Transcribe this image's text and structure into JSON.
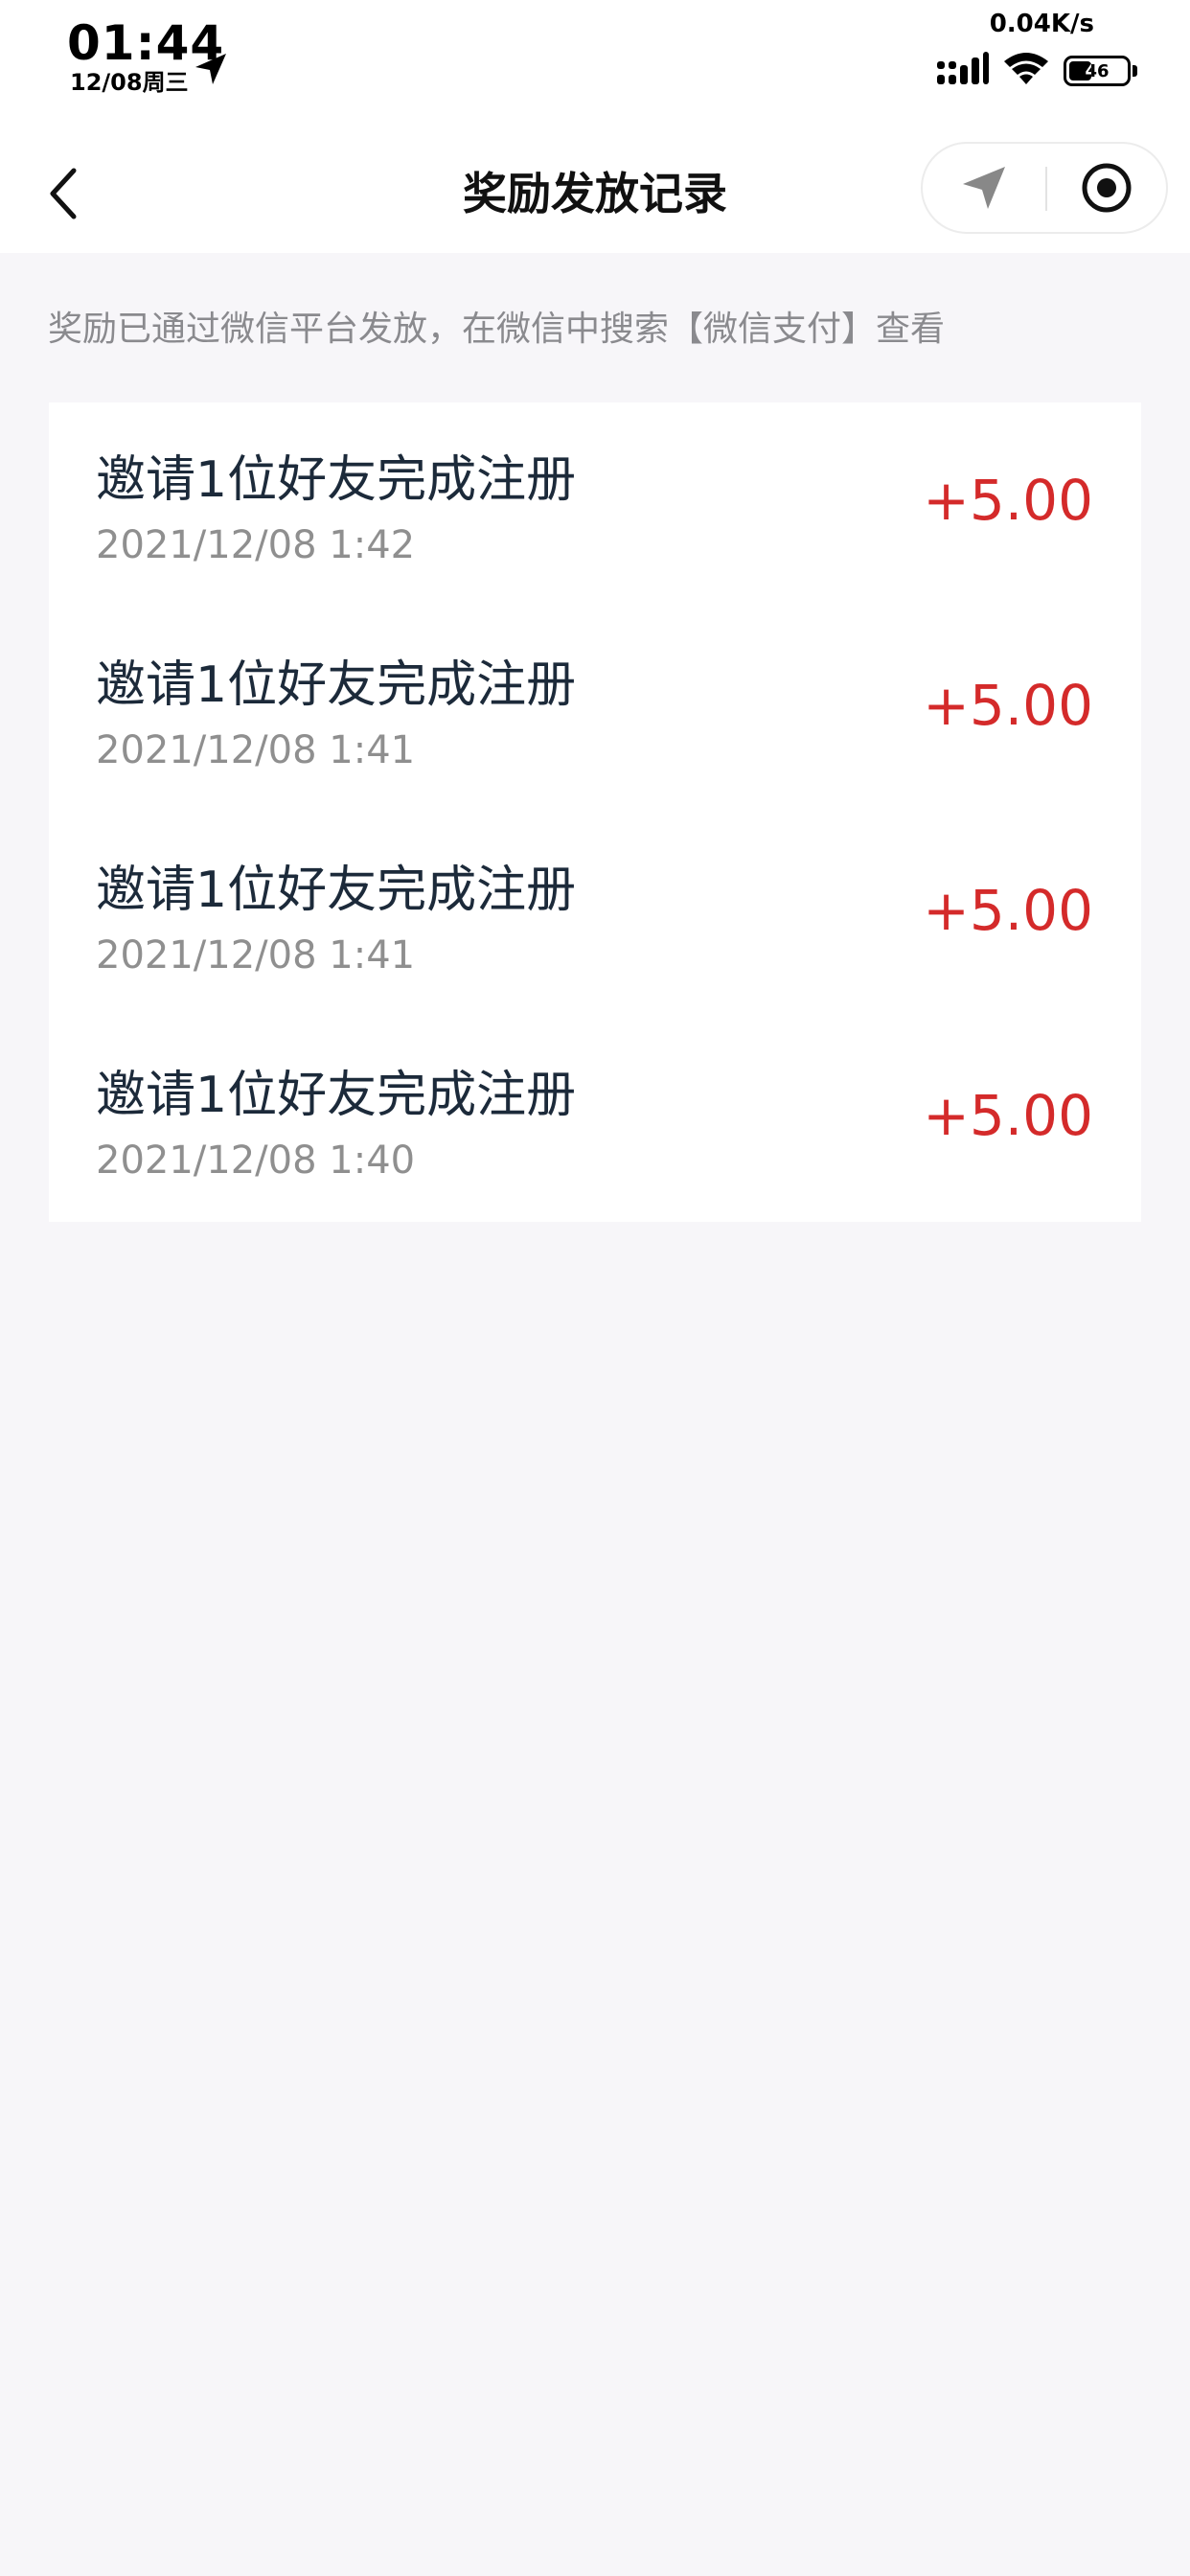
{
  "status_bar": {
    "time": "01:44",
    "date": "12/08周三",
    "network_speed": "0.04K/s",
    "battery": "46",
    "battery_level": 0.46
  },
  "nav": {
    "title": "奖励发放记录"
  },
  "notice": "奖励已通过微信平台发放，在微信中搜索【微信支付】查看",
  "records": [
    {
      "title": "邀请1位好友完成注册",
      "time": "2021/12/08 1:42",
      "amount": "+5.00"
    },
    {
      "title": "邀请1位好友完成注册",
      "time": "2021/12/08 1:41",
      "amount": "+5.00"
    },
    {
      "title": "邀请1位好友完成注册",
      "time": "2021/12/08 1:41",
      "amount": "+5.00"
    },
    {
      "title": "邀请1位好友完成注册",
      "time": "2021/12/08 1:40",
      "amount": "+5.00"
    }
  ],
  "colors": {
    "amount": "#d42a2a",
    "background": "#f7f6f9",
    "card": "#ffffff"
  }
}
